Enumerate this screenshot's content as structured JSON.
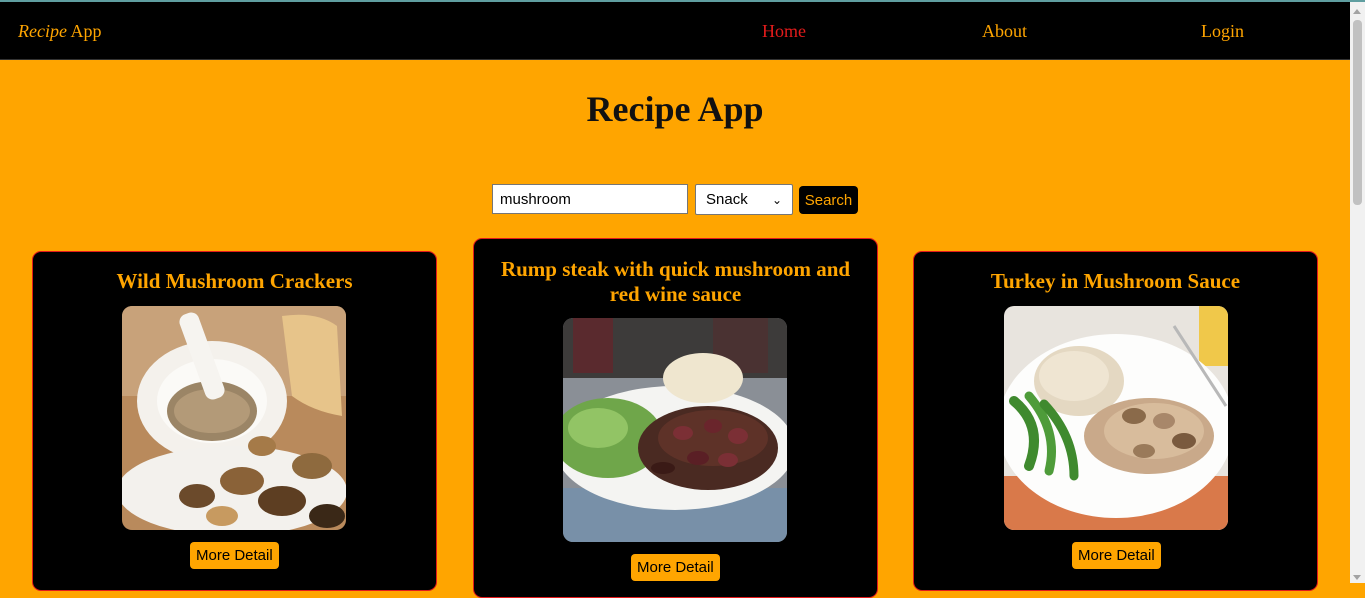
{
  "nav": {
    "brand_italic": "Recipe",
    "brand_rest": " App",
    "links": [
      "Home",
      "About",
      "Login"
    ],
    "active": "Home"
  },
  "page": {
    "title": "Recipe App"
  },
  "search": {
    "value": "mushroom",
    "category": "Snack",
    "button_label": "Search"
  },
  "recipes": [
    {
      "title": "Wild Mushroom Crackers",
      "button_label": "More Detail"
    },
    {
      "title": "Rump steak with quick mushroom and red wine sauce",
      "button_label": "More Detail"
    },
    {
      "title": "Turkey in Mushroom Sauce",
      "button_label": "More Detail"
    }
  ],
  "colors": {
    "accent": "#ffa500",
    "active_link": "#e31b1b",
    "navbar": "#000000",
    "card_border": "#e31b1b"
  }
}
